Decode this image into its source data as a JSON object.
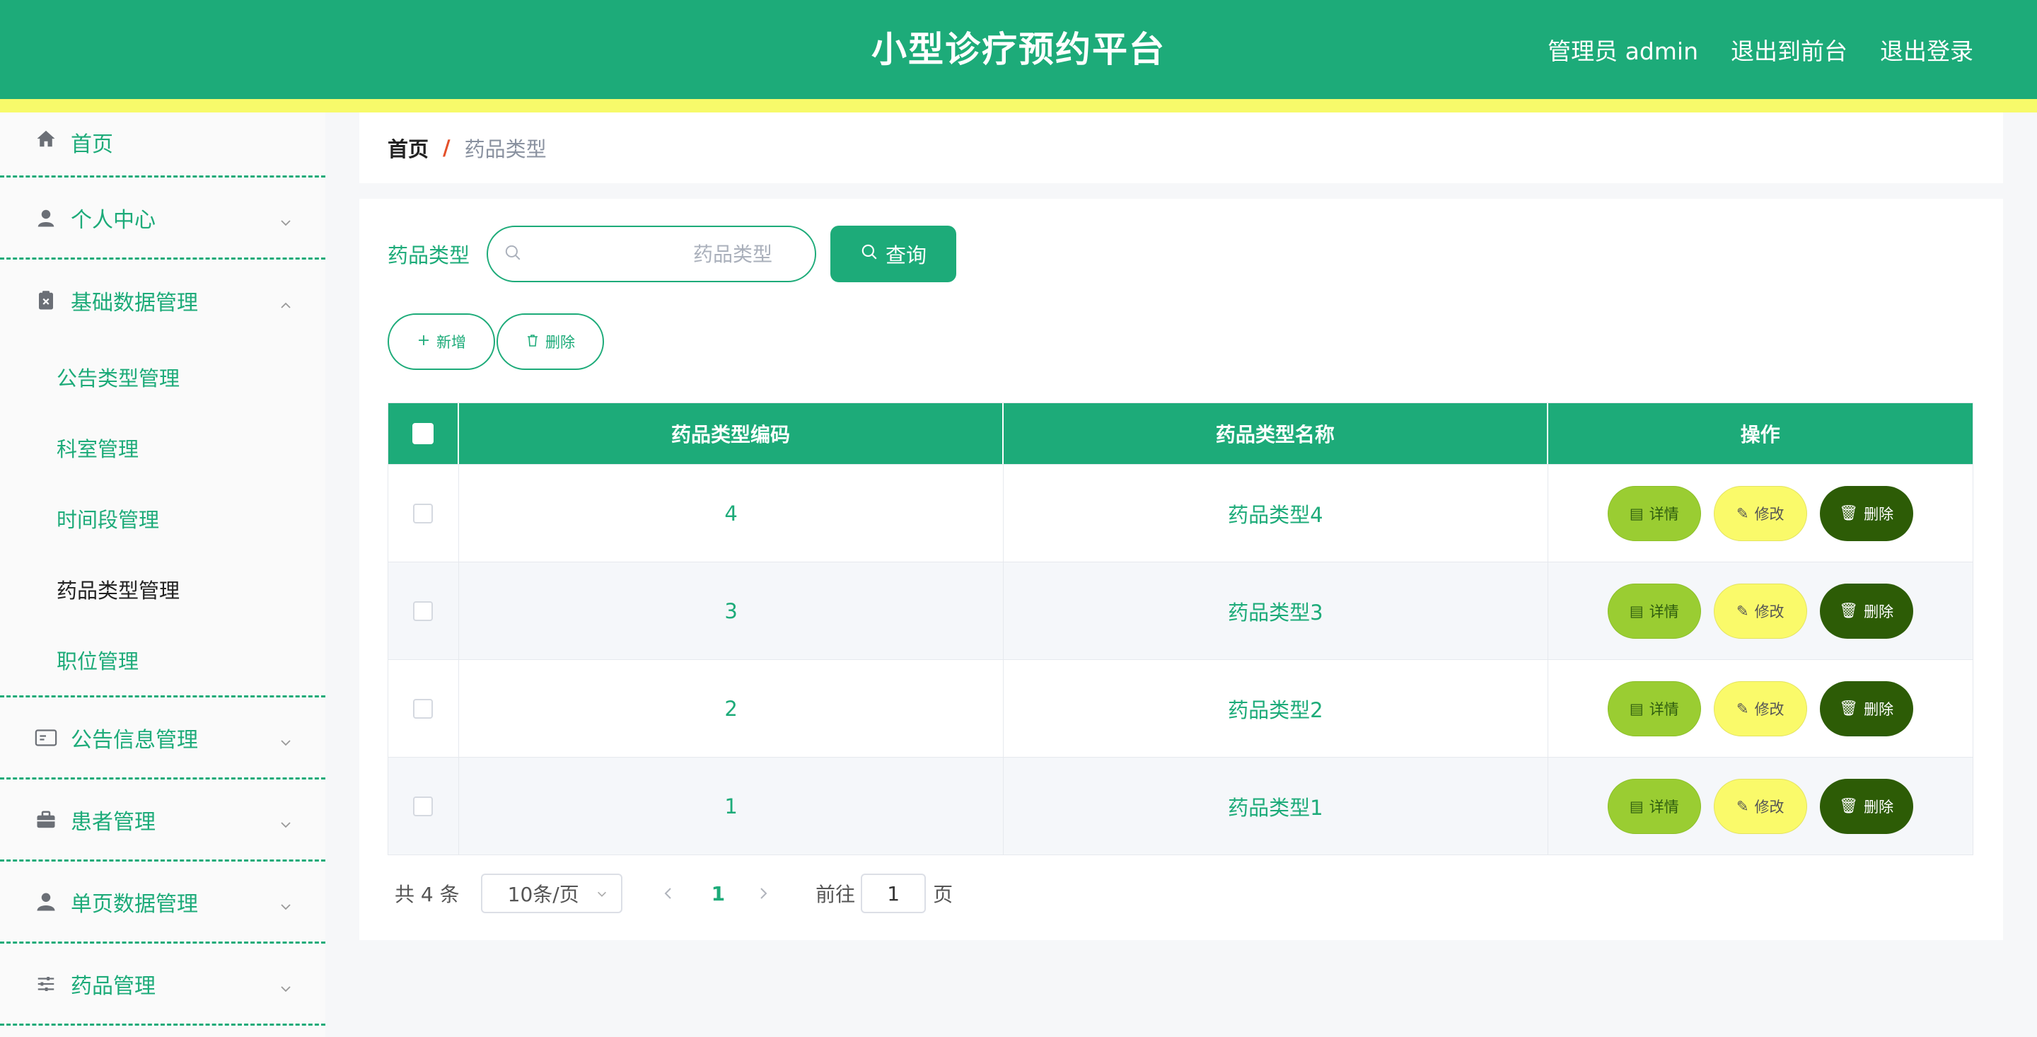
{
  "header": {
    "title": "小型诊疗预约平台",
    "admin_label": "管理员 admin",
    "to_front_label": "退出到前台",
    "logout_label": "退出登录"
  },
  "colors": {
    "primary": "#1dab79",
    "stripe": "#f7fa6a",
    "detail_button": "#9acd32",
    "edit_button": "#fafa6a",
    "delete_button": "#2d5c06"
  },
  "sidebar": {
    "home": {
      "label": "首页",
      "icon": "home-icon"
    },
    "personal": {
      "label": "个人中心",
      "icon": "user-icon"
    },
    "basic_data": {
      "label": "基础数据管理",
      "icon": "clipboard-icon",
      "expanded": true,
      "children": [
        {
          "label": "公告类型管理"
        },
        {
          "label": "科室管理"
        },
        {
          "label": "时间段管理"
        },
        {
          "label": "药品类型管理",
          "active": true
        },
        {
          "label": "职位管理"
        }
      ]
    },
    "notice": {
      "label": "公告信息管理",
      "icon": "card-icon"
    },
    "patient": {
      "label": "患者管理",
      "icon": "briefcase-icon"
    },
    "single_page": {
      "label": "单页数据管理",
      "icon": "person-icon"
    },
    "medicine": {
      "label": "药品管理",
      "icon": "sliders-icon"
    }
  },
  "breadcrumb": {
    "home": "首页",
    "separator": "/",
    "current": "药品类型"
  },
  "search": {
    "label": "药品类型",
    "placeholder": "药品类型",
    "value": "",
    "button": "查询"
  },
  "actions": {
    "add": "新增",
    "delete": "删除"
  },
  "table": {
    "columns": [
      "药品类型编码",
      "药品类型名称",
      "操作"
    ],
    "rows": [
      {
        "code": "4",
        "name": "药品类型4"
      },
      {
        "code": "3",
        "name": "药品类型3"
      },
      {
        "code": "2",
        "name": "药品类型2"
      },
      {
        "code": "1",
        "name": "药品类型1"
      }
    ],
    "ops": {
      "detail": "详情",
      "edit": "修改",
      "delete": "删除"
    }
  },
  "pagination": {
    "total": "共 4 条",
    "page_size": "10条/页",
    "current_page": "1",
    "goto_label": "前往",
    "goto_value": "1",
    "page_suffix": "页"
  }
}
